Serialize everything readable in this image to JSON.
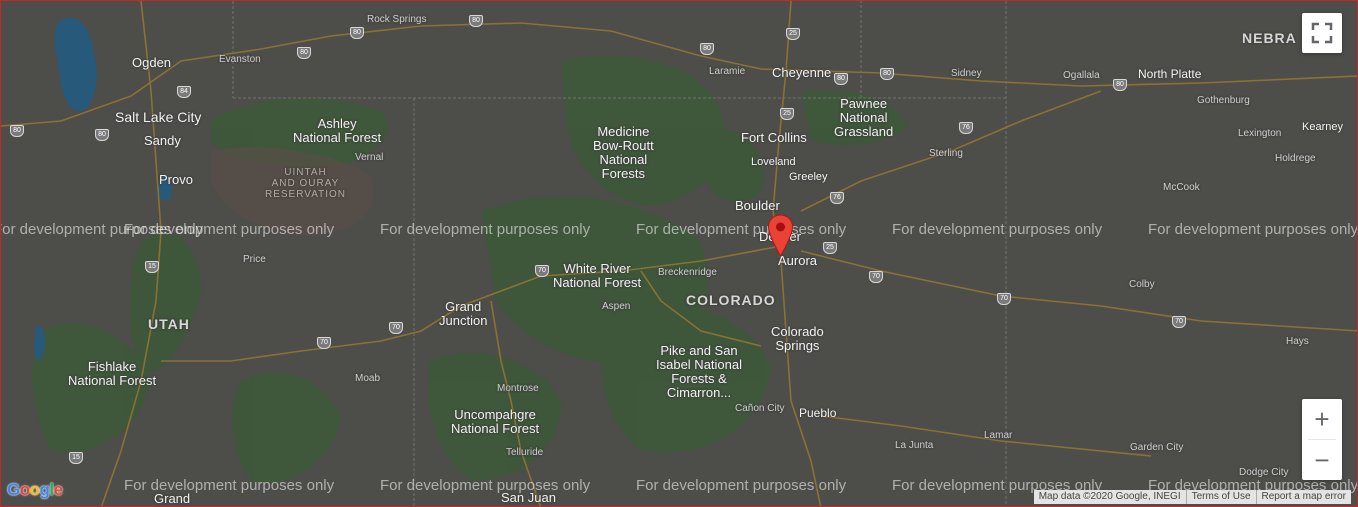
{
  "map": {
    "watermark": "For development purposes only",
    "logo_text": "Google",
    "logo_letters": [
      {
        "ch": "G",
        "color": "#4285F4"
      },
      {
        "ch": "o",
        "color": "#EA4335"
      },
      {
        "ch": "o",
        "color": "#FBBC05"
      },
      {
        "ch": "g",
        "color": "#4285F4"
      },
      {
        "ch": "l",
        "color": "#34A853"
      },
      {
        "ch": "e",
        "color": "#EA4335"
      }
    ],
    "attribution": {
      "map_data": "Map data ©2020 Google, INEGI",
      "terms": "Terms of Use",
      "report": "Report a map error"
    },
    "controls": {
      "zoom_in": "+",
      "zoom_out": "−"
    },
    "marker": {
      "color": "#EA4335"
    },
    "place_labels": {
      "rock_springs": "Rock Springs",
      "nebraska": "NEBRA",
      "ogden": "Ogden",
      "evanston": "Evanston",
      "laramie": "Laramie",
      "cheyenne": "Cheyenne",
      "sidney": "Sidney",
      "ogallala": "Ogallala",
      "north_platte": "North Platte",
      "salt_lake_city": "Salt Lake City",
      "ashley_nf": "Ashley\nNational Forest",
      "medicine_bow": "Medicine\nBow-Routt\nNational\nForests",
      "pawnee": "Pawnee\nNational\nGrassland",
      "gothenburg": "Gothenburg",
      "sandy": "Sandy",
      "vernal": "Vernal",
      "fort_collins": "Fort Collins",
      "kearney": "Kearney",
      "lexington": "Lexington",
      "loveland": "Loveland",
      "sterling": "Sterling",
      "holdrege": "Holdrege",
      "uintah": "UINTAH\nAND OURAY\nRESERVATION",
      "provo": "Provo",
      "greeley": "Greeley",
      "mccook": "McCook",
      "boulder": "Boulder",
      "denver": "Denver",
      "aurora": "Aurora",
      "price": "Price",
      "white_river": "White River\nNational Forest",
      "breckenridge": "Breckenridge",
      "colorado": "COLORADO",
      "colby": "Colby",
      "grand_junction": "Grand\nJunction",
      "aspen": "Aspen",
      "utah": "UTAH",
      "colorado_springs": "Colorado\nSprings",
      "hays": "Hays",
      "pike": "Pike and San\nIsabel National\nForests &\nCimarron...",
      "fishlake": "Fishlake\nNational Forest",
      "moab": "Moab",
      "montrose": "Montrose",
      "canon_city": "Cañon City",
      "pueblo": "Pueblo",
      "uncompahgre": "Uncompahgre\nNational Forest",
      "la_junta": "La Junta",
      "lamar": "Lamar",
      "garden_city": "Garden City",
      "telluride": "Telluride",
      "dodge_city": "Dodge City",
      "grand": "Grand",
      "san_juan": "San Juan"
    },
    "highway_shields": [
      "80",
      "80",
      "80",
      "80",
      "25",
      "80",
      "80",
      "80",
      "84",
      "80",
      "80",
      "25",
      "76",
      "76",
      "15",
      "70",
      "70",
      "70",
      "70",
      "70",
      "70",
      "25",
      "15"
    ]
  }
}
